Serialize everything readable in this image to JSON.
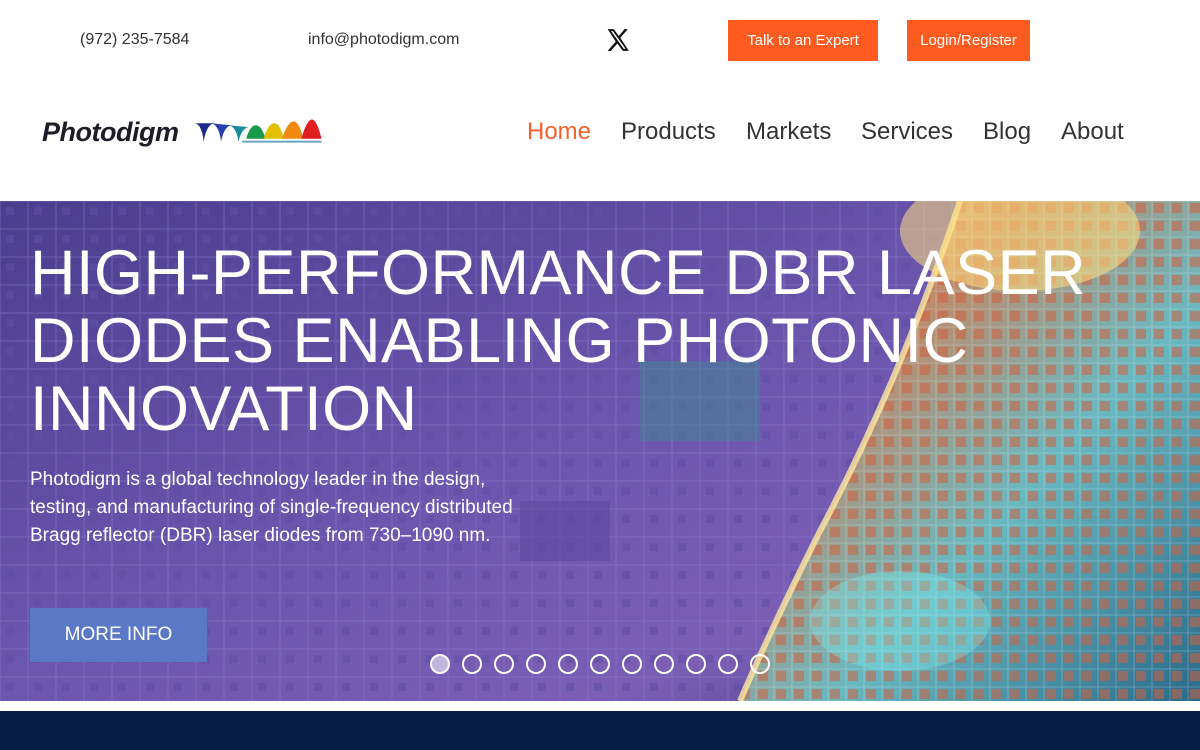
{
  "topbar": {
    "phone": "(972) 235-7584",
    "email": "info@photodigm.com",
    "social_icon": "x-twitter-icon",
    "expert_label": "Talk to an Expert",
    "login_label": "Login/Register"
  },
  "header": {
    "logo_text": "Photodigm",
    "nav": [
      {
        "label": "Home",
        "active": true
      },
      {
        "label": "Products",
        "active": false
      },
      {
        "label": "Markets",
        "active": false
      },
      {
        "label": "Services",
        "active": false
      },
      {
        "label": "Blog",
        "active": false
      },
      {
        "label": "About",
        "active": false
      }
    ]
  },
  "hero": {
    "title": "HIGH-PERFORMANCE DBR LASER DIODES ENABLING PHOTONIC INNOVATION",
    "description": "Photodigm is a global technology leader in the design, testing, and manufacturing of single-frequency distributed Bragg reflector (DBR) laser diodes from 730–1090 nm.",
    "button_label": "MORE INFO",
    "slide_count": 11,
    "active_slide": 1
  },
  "colors": {
    "accent_orange": "#ff5a1f",
    "nav_active": "#f4622a",
    "hero_button": "#5a78c6",
    "footer_band": "#071c45"
  }
}
